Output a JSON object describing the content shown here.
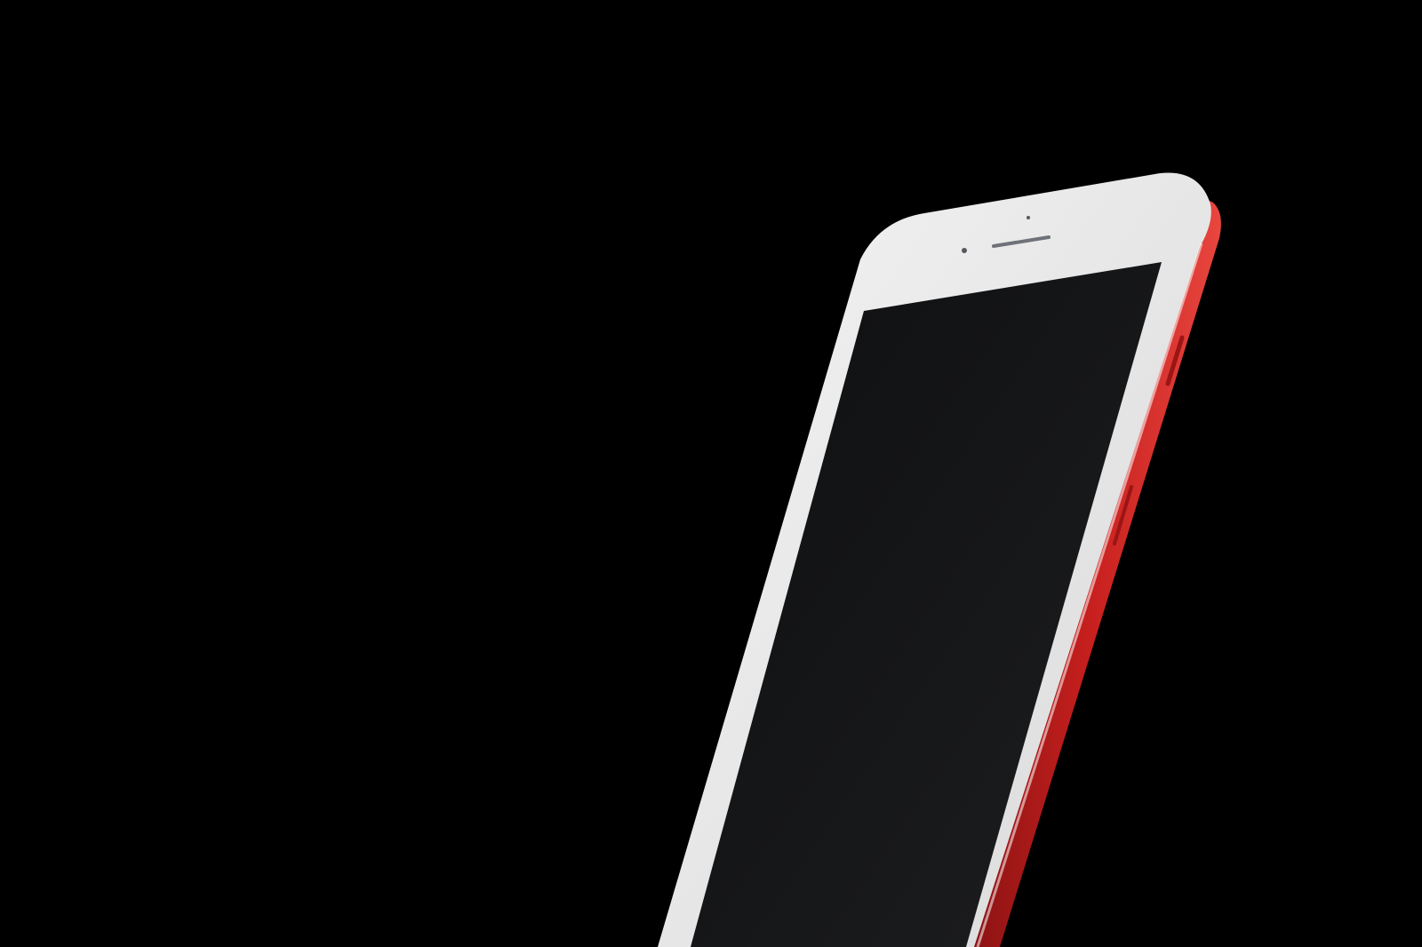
{
  "scene": {
    "subject": "smartphone",
    "colors": {
      "background": "#000000",
      "frame_red": "#c8201e",
      "frame_red_dark": "#7a0f10",
      "frame_red_highlight": "#e8463f",
      "bezel_white": "#f4f4f4",
      "bezel_shadow": "#d9d9d9",
      "screen_dark": "#0e0f10",
      "screen_light": "#1d1e20",
      "speaker_gray": "#6f7278"
    },
    "icons": {
      "speaker": "speaker-grille-icon",
      "camera": "front-camera-icon",
      "sensor": "proximity-sensor-icon",
      "side_button": "side-button-icon"
    }
  }
}
